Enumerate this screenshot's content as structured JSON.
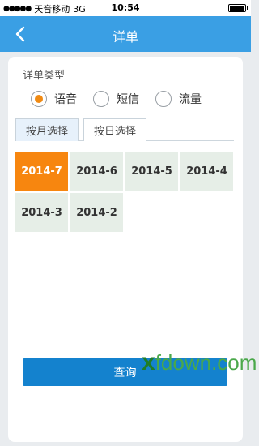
{
  "status_bar": {
    "signal": "●●●●●",
    "carrier": "天音移动",
    "network": "3G",
    "time": "10:54"
  },
  "nav": {
    "title": "详单",
    "back_icon": "chevron-left-icon"
  },
  "detail_type": {
    "label": "详单类型",
    "options": [
      {
        "label": "语音",
        "selected": true
      },
      {
        "label": "短信",
        "selected": false
      },
      {
        "label": "流量",
        "selected": false
      }
    ],
    "accent_color": "#f08a13"
  },
  "tabs": [
    {
      "label": "按月选择",
      "active": true
    },
    {
      "label": "按日选择",
      "active": false
    }
  ],
  "months": [
    {
      "label": "2014-7",
      "active": true
    },
    {
      "label": "2014-6",
      "active": false
    },
    {
      "label": "2014-5",
      "active": false
    },
    {
      "label": "2014-4",
      "active": false
    },
    {
      "label": "2014-3",
      "active": false
    },
    {
      "label": "2014-2",
      "active": false
    }
  ],
  "query_button": {
    "label": "查询"
  },
  "watermark": {
    "prefix": "x",
    "text": "fdown.com"
  },
  "colors": {
    "nav_bg": "#3a9fe4",
    "button_bg": "#1482ce",
    "cell_active": "#f7860f",
    "cell_bg": "#e6eee7"
  }
}
